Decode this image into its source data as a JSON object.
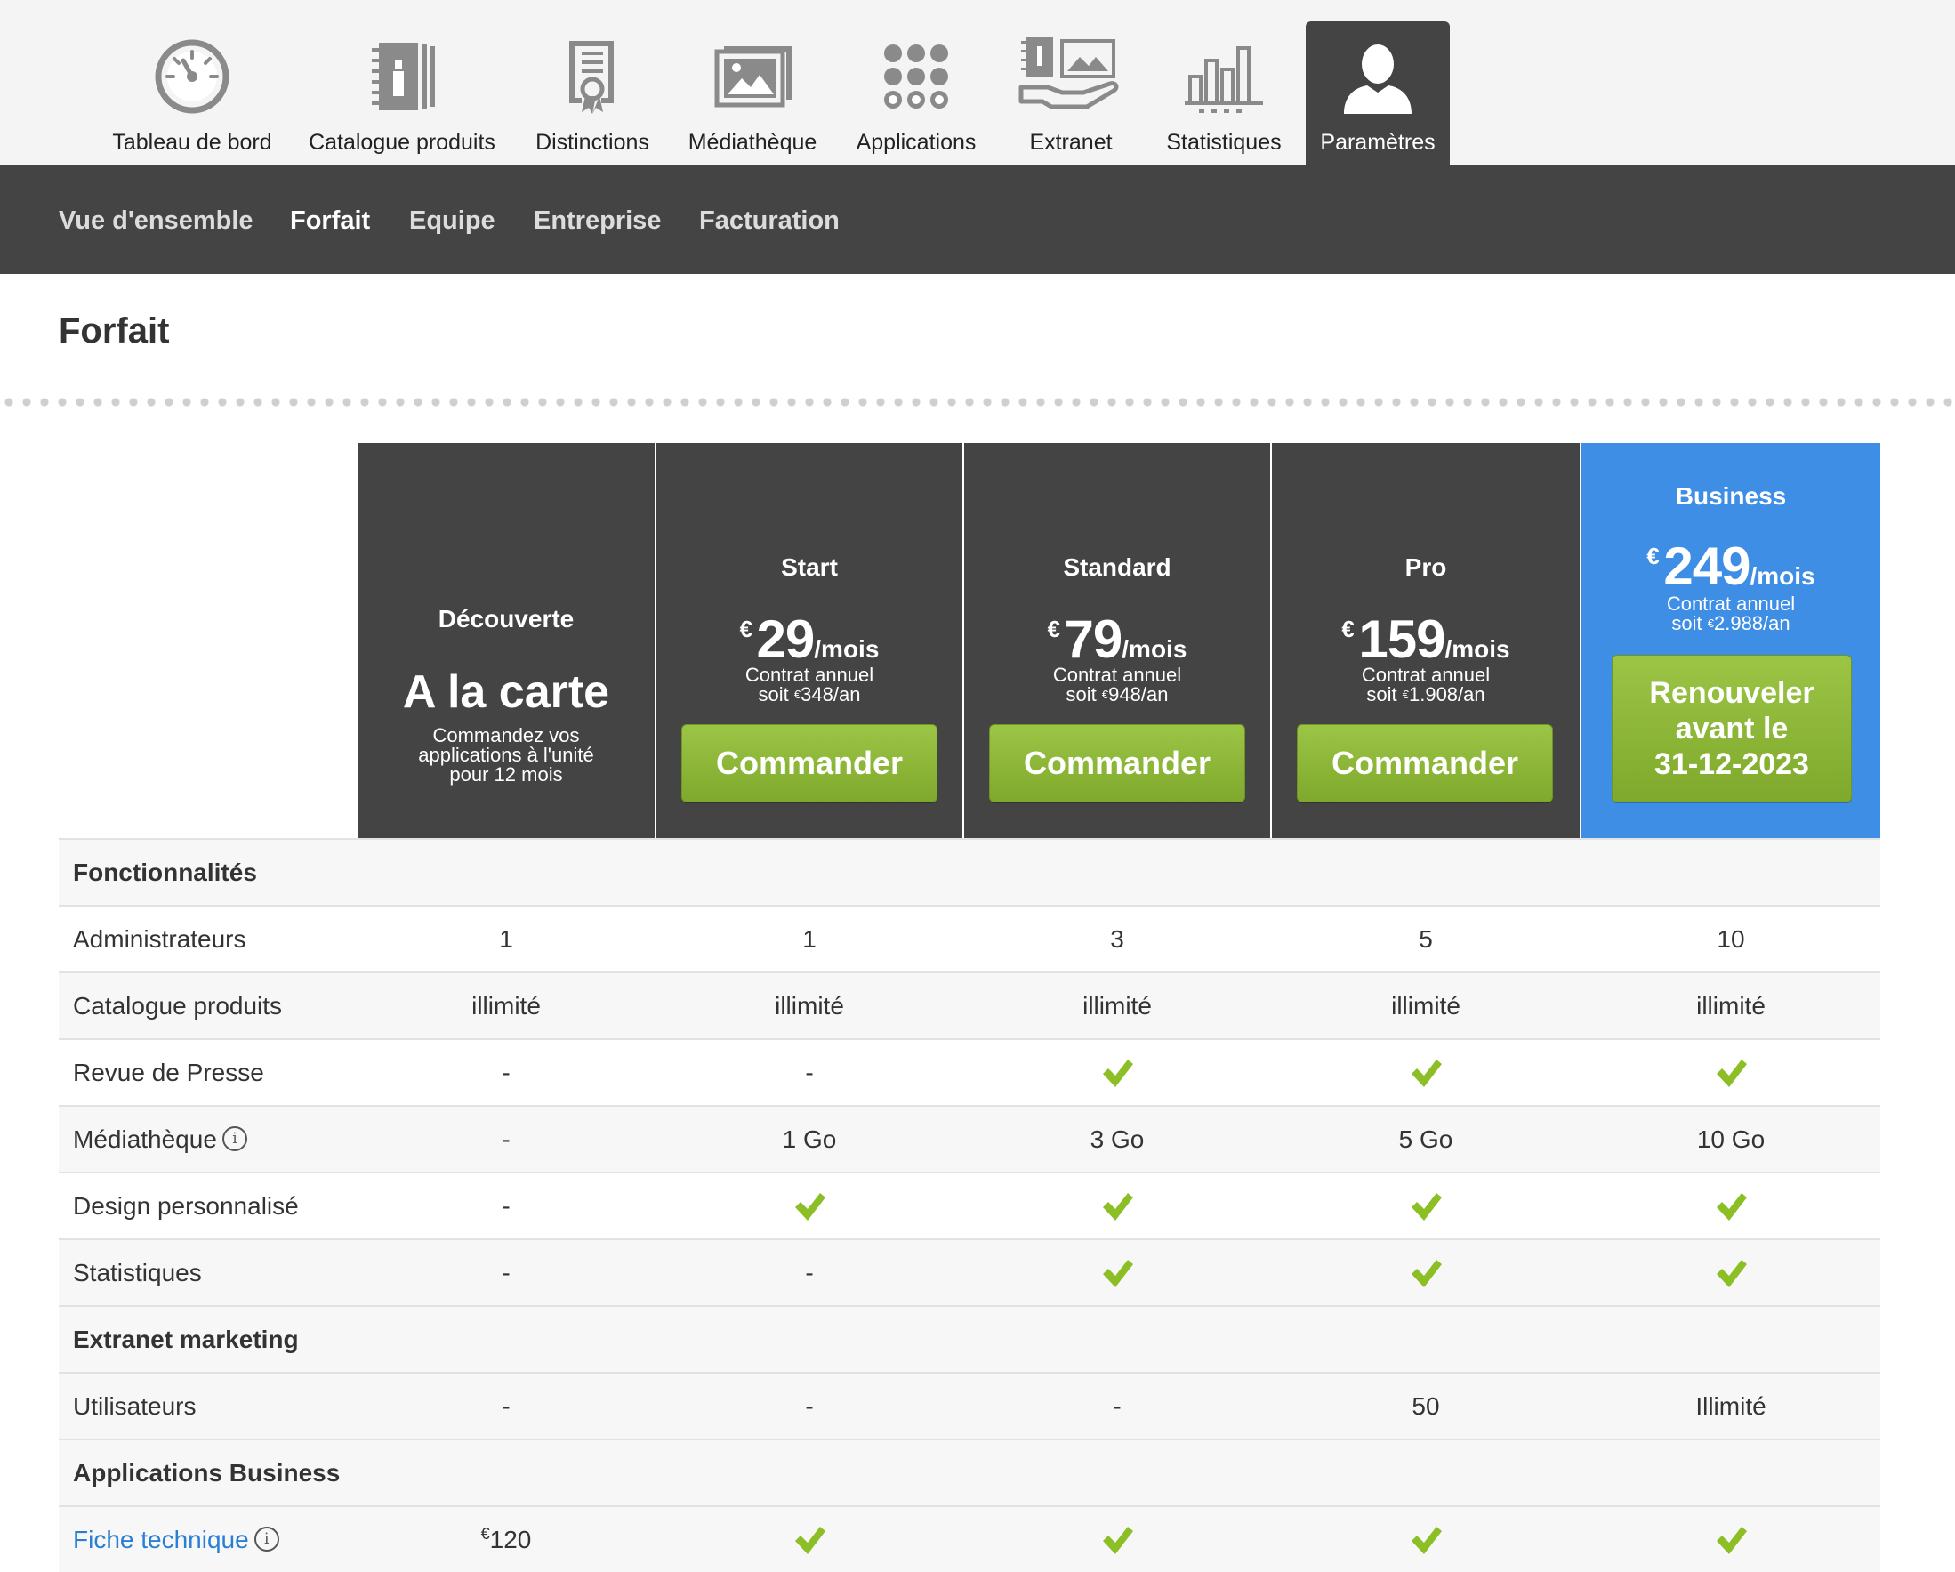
{
  "top_nav": {
    "items": [
      {
        "label": "Tableau de bord",
        "icon": "gauge-icon"
      },
      {
        "label": "Catalogue produits",
        "icon": "catalog-book-icon"
      },
      {
        "label": "Distinctions",
        "icon": "award-certificate-icon"
      },
      {
        "label": "Médiathèque",
        "icon": "picture-gallery-icon"
      },
      {
        "label": "Applications",
        "icon": "apps-grid-icon"
      },
      {
        "label": "Extranet",
        "icon": "hand-holding-media-icon"
      },
      {
        "label": "Statistiques",
        "icon": "bar-chart-icon"
      },
      {
        "label": "Paramètres",
        "icon": "user-silhouette-icon",
        "active": true
      }
    ]
  },
  "sub_nav": {
    "items": [
      "Vue d'ensemble",
      "Forfait",
      "Equipe",
      "Entreprise",
      "Facturation"
    ],
    "active": "Forfait"
  },
  "page": {
    "title": "Forfait"
  },
  "plans": [
    {
      "name": "Découverte",
      "headline": "A la carte",
      "desc_line1": "Commandez vos",
      "desc_line2": "applications à l'unité",
      "desc_line3": "pour 12 mois"
    },
    {
      "name": "Start",
      "currency": "€",
      "price": "29",
      "per": "/mois",
      "contract": "Contrat annuel",
      "yearly_prefix": "soit",
      "yearly": "348/an",
      "button": "Commander"
    },
    {
      "name": "Standard",
      "currency": "€",
      "price": "79",
      "per": "/mois",
      "contract": "Contrat annuel",
      "yearly_prefix": "soit",
      "yearly": "948/an",
      "button": "Commander"
    },
    {
      "name": "Pro",
      "currency": "€",
      "price": "159",
      "per": "/mois",
      "contract": "Contrat annuel",
      "yearly_prefix": "soit",
      "yearly": "1.908/an",
      "button": "Commander"
    },
    {
      "name": "Business",
      "currency": "€",
      "price": "249",
      "per": "/mois",
      "contract": "Contrat annuel",
      "yearly_prefix": "soit",
      "yearly": "2.988/an",
      "button_line1": "Renouveler",
      "button_line2": "avant le",
      "button_line3": "31-12-2023"
    }
  ],
  "colors": {
    "header_dark": "#444444",
    "business_blue": "#3f8ee6",
    "button_green": "#8cb83a",
    "check_green": "#8cbf26",
    "link_blue": "#2a7fd4"
  },
  "table": {
    "rows": [
      {
        "type": "section",
        "label": "Fonctionnalités"
      },
      {
        "label": "Administrateurs",
        "values": [
          "1",
          "1",
          "3",
          "5",
          "10"
        ]
      },
      {
        "label": "Catalogue produits",
        "values": [
          "illimité",
          "illimité",
          "illimité",
          "illimité",
          "illimité"
        ]
      },
      {
        "label": "Revue de Presse",
        "values": [
          "-",
          "-",
          "check",
          "check",
          "check"
        ]
      },
      {
        "label": "Médiathèque",
        "info": true,
        "values": [
          "-",
          "1 Go",
          "3 Go",
          "5 Go",
          "10 Go"
        ]
      },
      {
        "label": "Design personnalisé",
        "values": [
          "-",
          "check",
          "check",
          "check",
          "check"
        ]
      },
      {
        "label": "Statistiques",
        "values": [
          "-",
          "-",
          "check",
          "check",
          "check"
        ]
      },
      {
        "type": "section",
        "label": "Extranet marketing"
      },
      {
        "label": "Utilisateurs",
        "values": [
          "-",
          "-",
          "-",
          "50",
          "Illimité"
        ]
      },
      {
        "type": "section",
        "label": "Applications Business"
      },
      {
        "label": "Fiche technique",
        "info": true,
        "link": true,
        "values": [
          "€120",
          "check",
          "check",
          "check",
          "check"
        ]
      }
    ]
  }
}
